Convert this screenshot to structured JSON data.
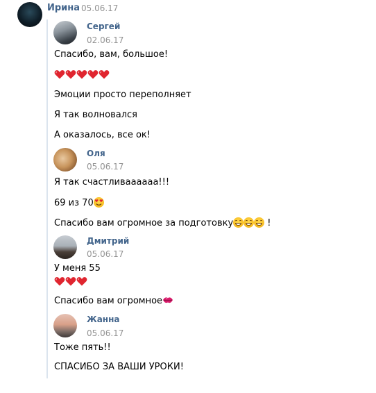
{
  "post": {
    "author": "Ирина",
    "date": "05.06.17"
  },
  "replies": [
    {
      "sender": "Сергей",
      "date": "02.06.17",
      "lines": [
        {
          "text": "Спасибо, вам, большое!"
        },
        {
          "emoji": "hearts",
          "count": 5
        },
        {
          "text": "Эмоции просто переполняет"
        },
        {
          "text": "Я так волновался"
        },
        {
          "text": "А оказалось, все ок!"
        }
      ]
    },
    {
      "sender": "Оля",
      "date": "05.06.17",
      "lines": [
        {
          "text": "Я так счастливаааааа!!!"
        },
        {
          "text": "69 из 70",
          "trailing_emoji": "heart-eyes-icon"
        },
        {
          "text": "Спасибо вам огромное за подготовку",
          "trailing_emoji": "grin-icon",
          "trailing_count": 3,
          "suffix": " !"
        }
      ]
    },
    {
      "sender": "Дмитрий",
      "date": "05.06.17",
      "lines": [
        {
          "text": "У меня 55"
        },
        {
          "emoji": "hearts",
          "count": 3
        },
        {
          "text": "Спасибо вам огромное",
          "trailing_emoji": "kiss-lips-icon"
        }
      ]
    },
    {
      "sender": "Жанна",
      "date": "05.06.17",
      "lines": [
        {
          "text": "Тоже пять!!"
        },
        {
          "text": "СПАСИБО ЗА ВАШИ УРОКИ!"
        }
      ]
    }
  ],
  "colors": {
    "name": "#42648b",
    "date": "#939393",
    "heart": "#e0252f",
    "quote_bar": "#dbe4ee"
  }
}
